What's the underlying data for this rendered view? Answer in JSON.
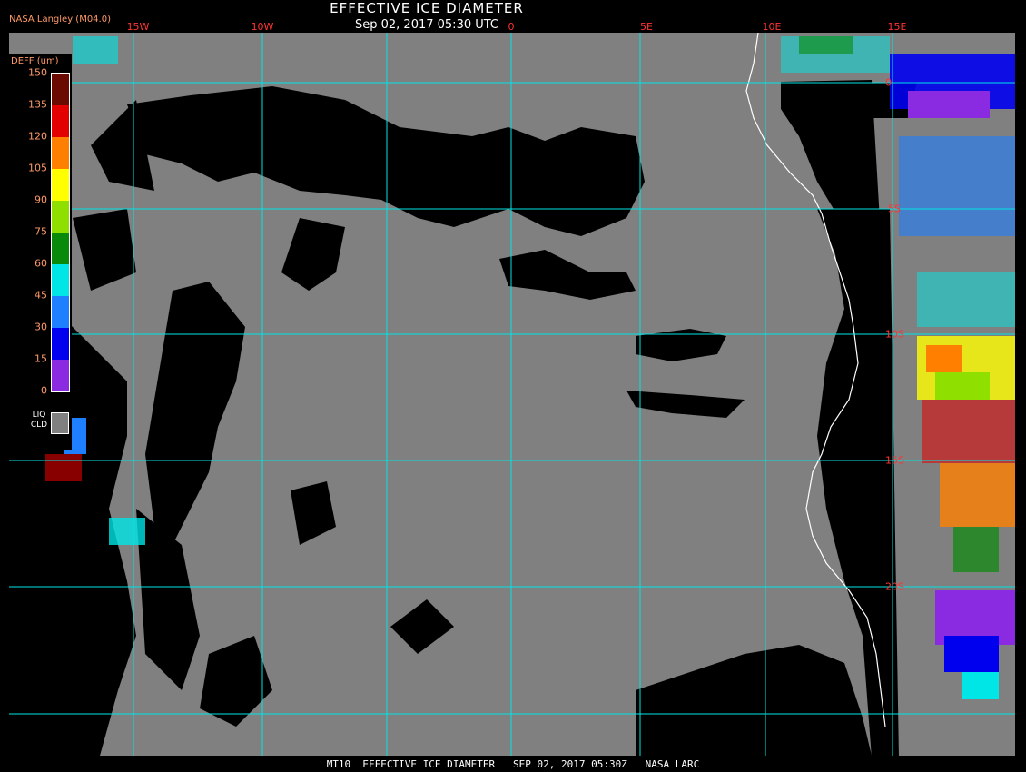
{
  "header": {
    "title": "EFFECTIVE ICE DIAMETER",
    "datetime": "Sep 02, 2017 05:30 UTC",
    "producer": "NASA Langley (M04.0)"
  },
  "footer": {
    "text": "MT10  EFFECTIVE ICE DIAMETER   SEP 02, 2017 05:30Z   NASA LARC"
  },
  "longitude_labels": [
    "15W",
    "10W",
    "0",
    "5E",
    "10E",
    "15E"
  ],
  "latitude_labels": [
    "0",
    "5S",
    "10S",
    "15S",
    "20S"
  ],
  "legend": {
    "title": "DEFF (um)",
    "ticks": [
      "150",
      "135",
      "120",
      "105",
      "90",
      "75",
      "60",
      "45",
      "30",
      "15",
      "0"
    ],
    "colors": [
      "#6b0a00",
      "#e20000",
      "#ff7f00",
      "#ffff00",
      "#8fe000",
      "#0a8a0a",
      "#00e5e5",
      "#1e7fff",
      "#0000ee",
      "#8a2be2"
    ],
    "liquid_label_line1": "LIQ",
    "liquid_label_line2": "CLD",
    "liquid_color": "#808080"
  },
  "colors": {
    "grid": "#00e5e5",
    "ocean_liquid": "#808080",
    "clear": "#000000",
    "coastline": "#ffffff"
  }
}
